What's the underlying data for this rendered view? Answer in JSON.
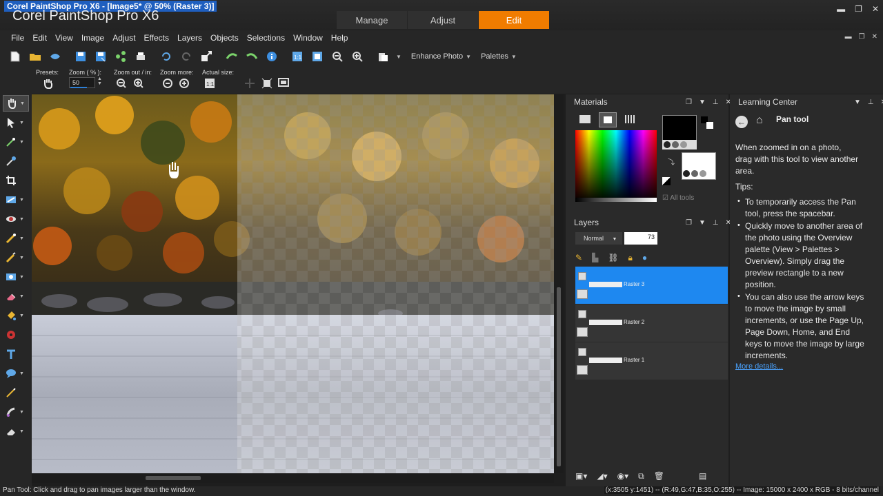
{
  "window": {
    "title": "Corel PaintShop Pro X6 - [Image5* @  50% (Raster 3)]",
    "app_name": "Corel PaintShop Pro X6"
  },
  "workspace_tabs": [
    {
      "label": "Manage",
      "active": false
    },
    {
      "label": "Adjust",
      "active": false
    },
    {
      "label": "Edit",
      "active": true
    }
  ],
  "menu": [
    "File",
    "Edit",
    "View",
    "Image",
    "Adjust",
    "Effects",
    "Layers",
    "Objects",
    "Selections",
    "Window",
    "Help"
  ],
  "toolbar": {
    "enhance_photo_label": "Enhance Photo",
    "palettes_label": "Palettes"
  },
  "tool_options": {
    "presets_label": "Presets:",
    "zoom_label": "Zoom ( % ):",
    "zoom_value": "50",
    "zoom_in_out_label": "Zoom out / in:",
    "zoom_more_label": "Zoom more:",
    "actual_size_label": "Actual size:"
  },
  "materials": {
    "title": "Materials",
    "all_tools_label": "All tools",
    "foreground_color": "#000000",
    "background_color": "#ffffff"
  },
  "layers": {
    "title": "Layers",
    "blend_mode": "Normal",
    "opacity": "73",
    "items": [
      {
        "name": "Raster 3",
        "selected": true
      },
      {
        "name": "Raster 2",
        "selected": false
      },
      {
        "name": "Raster 1",
        "selected": false
      }
    ]
  },
  "learning_center": {
    "title": "Learning Center",
    "tool_name": "Pan tool",
    "description": "When zoomed in on a photo, drag with this tool to view another area.",
    "tips_label": "Tips:",
    "tips": [
      "To temporarily access the Pan tool, press the spacebar.",
      "Quickly move to another area of the photo using the Overview palette (View > Palettes > Overview). Simply drag the preview rectangle to a new position.",
      "You can also use the arrow keys to move the image by small increments, or use the Page Up, Page Down, Home, and End keys to move the image by large increments."
    ],
    "more_details": "More details..."
  },
  "status": {
    "left": "Pan Tool: Click and drag to pan images larger than the window.",
    "right": "(x:3505 y:1451) -- (R:49,G:47,B:35,O:255) -- Image:  15000 x 2400 x RGB - 8 bits/channel"
  },
  "colors": {
    "accent": "#f07c00",
    "selection": "#1e88f0",
    "link": "#4aa3ff"
  }
}
